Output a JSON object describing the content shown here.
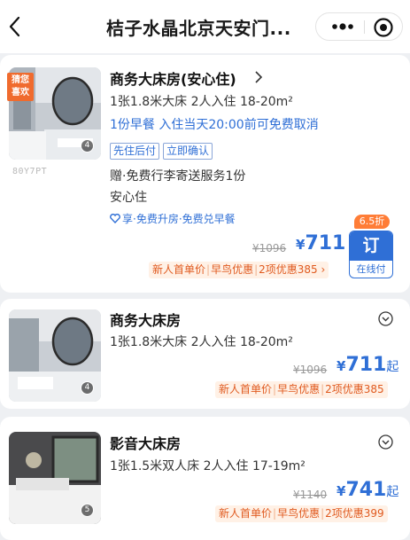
{
  "header": {
    "title": "桔子水晶北京天安门..."
  },
  "card1": {
    "tag": [
      "猜您",
      "喜欢"
    ],
    "photo_count": "4",
    "code": "80Y7PT",
    "name": "商务大床房(安心住)",
    "spec": "1张1.8米大床  2人入住  18-20m²",
    "breakfast_cancel": "1份早餐  入住当天20:00前可免费取消",
    "badges": [
      "先住后付",
      "立即确认"
    ],
    "gift": "赠·免费行李寄送服务1份",
    "safe": "安心住",
    "perk": "享·免费升房·免费兑早餐",
    "original_price": "¥1096",
    "currency": "¥",
    "price": "711",
    "promo": {
      "a": "新人首单价",
      "b": "早鸟优惠",
      "c": "2项优惠385",
      "arrow": "›"
    },
    "discount": "6.5折",
    "book": {
      "label": "订",
      "sub": "在线付"
    }
  },
  "card2": {
    "photo_count": "4",
    "name": "商务大床房",
    "spec": "1张1.8米大床  2人入住  18-20m²",
    "original_price": "¥1096",
    "currency": "¥",
    "price": "711",
    "suffix": "起",
    "promo": {
      "a": "新人首单价",
      "b": "早鸟优惠",
      "c": "2项优惠385"
    }
  },
  "card3": {
    "photo_count": "5",
    "name": "影音大床房",
    "spec": "1张1.5米双人床  2人入住  17-19m²",
    "original_price": "¥1140",
    "currency": "¥",
    "price": "741",
    "suffix": "起",
    "promo": {
      "a": "新人首单价",
      "b": "早鸟优惠",
      "c": "2项优惠399"
    }
  },
  "icons": {
    "back": "chevron-left-icon",
    "more": "more-dots-icon",
    "target": "target-icon",
    "expand": "chevron-down-circle-icon",
    "perk": "heart-icon"
  },
  "colors": {
    "brand_blue": "#2f6fd6",
    "promo_orange": "#e05a1f",
    "tag_orange": "#f06b2e"
  }
}
